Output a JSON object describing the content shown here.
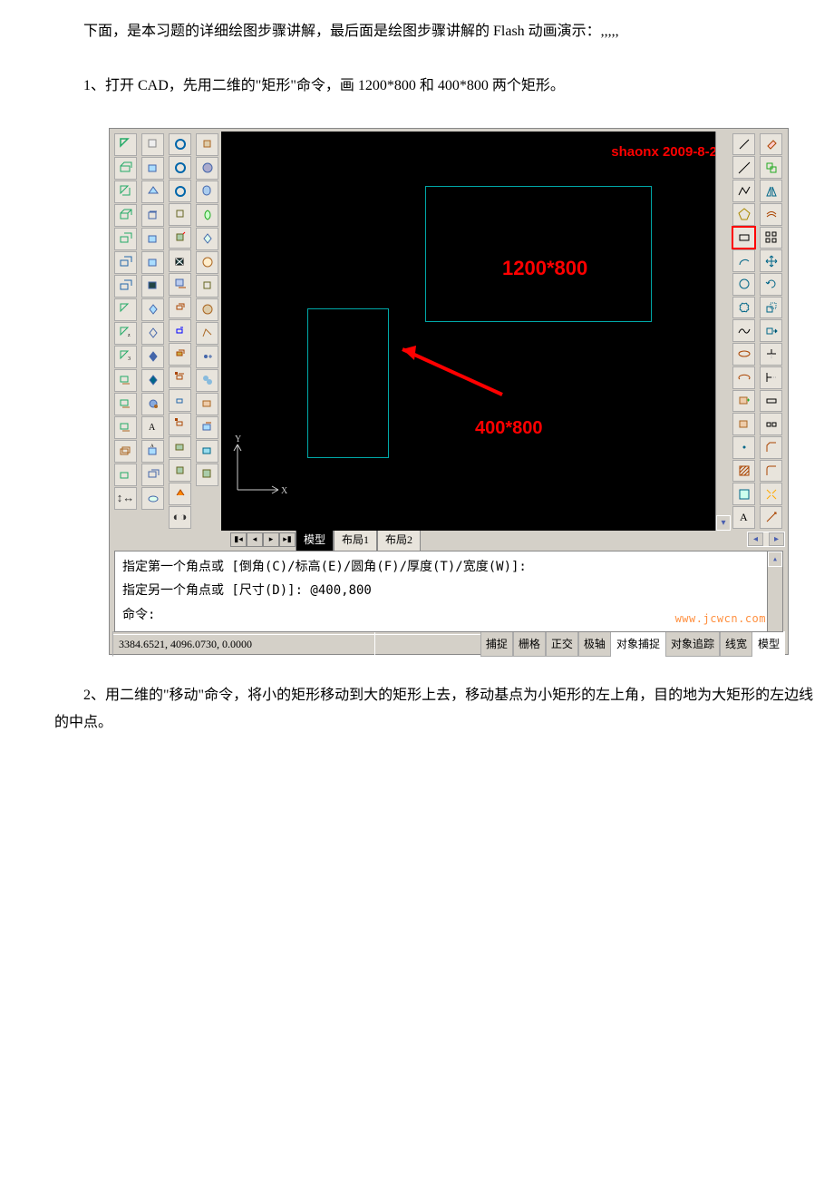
{
  "p1": "下面，是本习题的详细绘图步骤讲解，最后面是绘图步骤讲解的 Flash 动画演示：,,,,,",
  "p2": "1、打开 CAD，先用二维的\"矩形\"命令，画 1200*800 和 400*800 两个矩形。",
  "p3": "2、用二维的\"移动\"命令，将小的矩形移动到大的矩形上去，移动基点为小矩形的左上角，目的地为大矩形的左边线的中点。",
  "canvas": {
    "watermark": "shaonx 2009-8-2",
    "label_big": "1200*800",
    "label_small": "400*800",
    "axis_x": "X",
    "axis_y": "Y"
  },
  "tabs": {
    "model": "模型",
    "layout1": "布局1",
    "layout2": "布局2"
  },
  "cmd": {
    "line1": "指定第一个角点或 [倒角(C)/标高(E)/圆角(F)/厚度(T)/宽度(W)]:",
    "line2": "指定另一个角点或 [尺寸(D)]: @400,800",
    "prompt": "命令:",
    "site": "www.jcwcn.com"
  },
  "status": {
    "coords": "3384.6521, 4096.0730, 0.0000",
    "snap": "捕捉",
    "grid": "栅格",
    "ortho": "正交",
    "polar": "极轴",
    "osnap": "对象捕捉",
    "otrack": "对象追踪",
    "lwt": "线宽",
    "model": "模型"
  }
}
